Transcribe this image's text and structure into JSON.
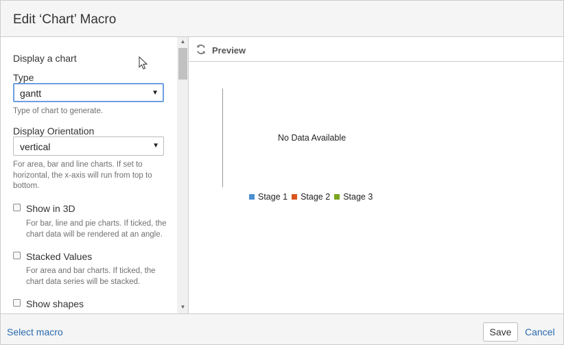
{
  "dialog": {
    "title": "Edit ‘Chart’ Macro"
  },
  "left": {
    "section_title": "Display a chart",
    "type_label": "Type",
    "type_value": "gantt",
    "type_help": "Type of chart to generate.",
    "orientation_label": "Display Orientation",
    "orientation_value": "vertical",
    "orientation_help": "For area, bar and line charts. If set to horizontal, the x-axis will run from top to bottom.",
    "show3d_label": "Show in 3D",
    "show3d_help": "For bar, line and pie charts. If ticked, the chart data will be rendered at an angle.",
    "stacked_label": "Stacked Values",
    "stacked_help": "For area and bar charts. If ticked, the chart data series will be stacked.",
    "shapes_label": "Show shapes"
  },
  "preview": {
    "label": "Preview",
    "no_data": "No Data Available",
    "legend": [
      {
        "name": "Stage 1",
        "color": "#4a8fd1"
      },
      {
        "name": "Stage 2",
        "color": "#d9541e"
      },
      {
        "name": "Stage 3",
        "color": "#7aa51f"
      }
    ]
  },
  "footer": {
    "select_macro": "Select macro",
    "save": "Save",
    "cancel": "Cancel"
  },
  "icons": {
    "refresh": "refresh-icon",
    "caret": "chevron-down-icon"
  }
}
